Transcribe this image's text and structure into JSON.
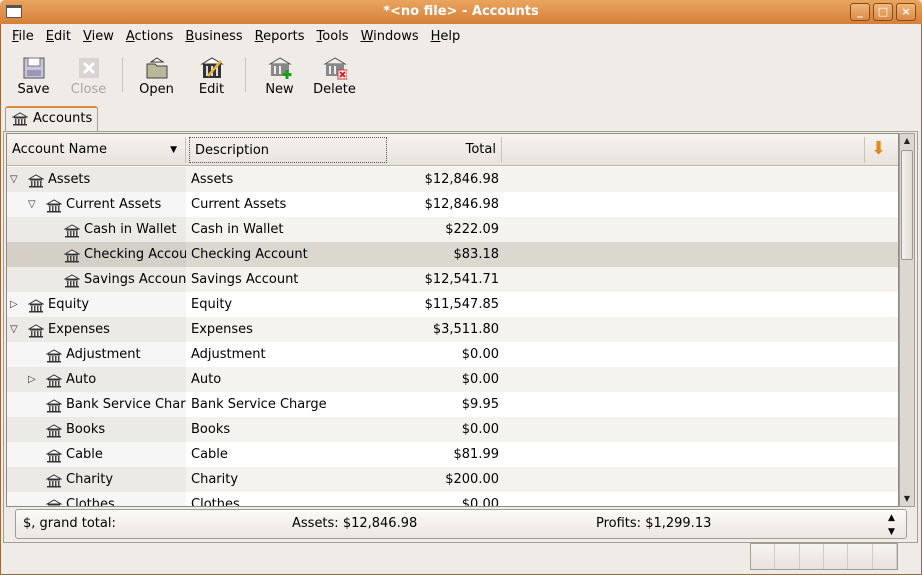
{
  "window": {
    "title": "*<no file> - Accounts",
    "buttons": [
      "_",
      "□",
      "×"
    ]
  },
  "menu": [
    "File",
    "Edit",
    "View",
    "Actions",
    "Business",
    "Reports",
    "Tools",
    "Windows",
    "Help"
  ],
  "toolbar": [
    {
      "label": "Save",
      "icon": "save-icon",
      "enabled": true
    },
    {
      "label": "Close",
      "icon": "close-icon",
      "enabled": false
    },
    {
      "label": "Open",
      "icon": "open-icon",
      "enabled": true
    },
    {
      "label": "Edit",
      "icon": "edit-icon",
      "enabled": true
    },
    {
      "label": "New",
      "icon": "new-account-icon",
      "enabled": true
    },
    {
      "label": "Delete",
      "icon": "delete-account-icon",
      "enabled": true
    }
  ],
  "tab": {
    "label": "Accounts"
  },
  "columns": {
    "name": "Account Name",
    "description": "Description",
    "total": "Total"
  },
  "rows": [
    {
      "name": "Assets",
      "description": "Assets",
      "total": "$12,846.98",
      "level": 0,
      "expander": "open"
    },
    {
      "name": "Current Assets",
      "description": "Current Assets",
      "total": "$12,846.98",
      "level": 1,
      "expander": "open"
    },
    {
      "name": "Cash in Wallet",
      "description": "Cash in Wallet",
      "total": "$222.09",
      "level": 2,
      "expander": "none"
    },
    {
      "name": "Checking Account",
      "description": "Checking Account",
      "total": "$83.18",
      "level": 2,
      "expander": "none",
      "selected": true
    },
    {
      "name": "Savings Account",
      "description": "Savings Account",
      "total": "$12,541.71",
      "level": 2,
      "expander": "none"
    },
    {
      "name": "Equity",
      "description": "Equity",
      "total": "$11,547.85",
      "level": 0,
      "expander": "closed"
    },
    {
      "name": "Expenses",
      "description": "Expenses",
      "total": "$3,511.80",
      "level": 0,
      "expander": "open"
    },
    {
      "name": "Adjustment",
      "description": "Adjustment",
      "total": "$0.00",
      "level": 1,
      "expander": "none"
    },
    {
      "name": "Auto",
      "description": "Auto",
      "total": "$0.00",
      "level": 1,
      "expander": "closed"
    },
    {
      "name": "Bank Service Charge",
      "description": "Bank Service Charge",
      "total": "$9.95",
      "level": 1,
      "expander": "none"
    },
    {
      "name": "Books",
      "description": "Books",
      "total": "$0.00",
      "level": 1,
      "expander": "none"
    },
    {
      "name": "Cable",
      "description": "Cable",
      "total": "$81.99",
      "level": 1,
      "expander": "none"
    },
    {
      "name": "Charity",
      "description": "Charity",
      "total": "$200.00",
      "level": 1,
      "expander": "none"
    },
    {
      "name": "Clothes",
      "description": "Clothes",
      "total": "$0.00",
      "level": 1,
      "expander": "none"
    }
  ],
  "summary": {
    "label": "$, grand total:",
    "assets": "Assets: $12,846.98",
    "profits": "Profits: $1,299.13"
  },
  "colors": {
    "titlebar": "#d6803a",
    "selected_row": "#ddd8cf",
    "accent": "#e08a3c"
  }
}
